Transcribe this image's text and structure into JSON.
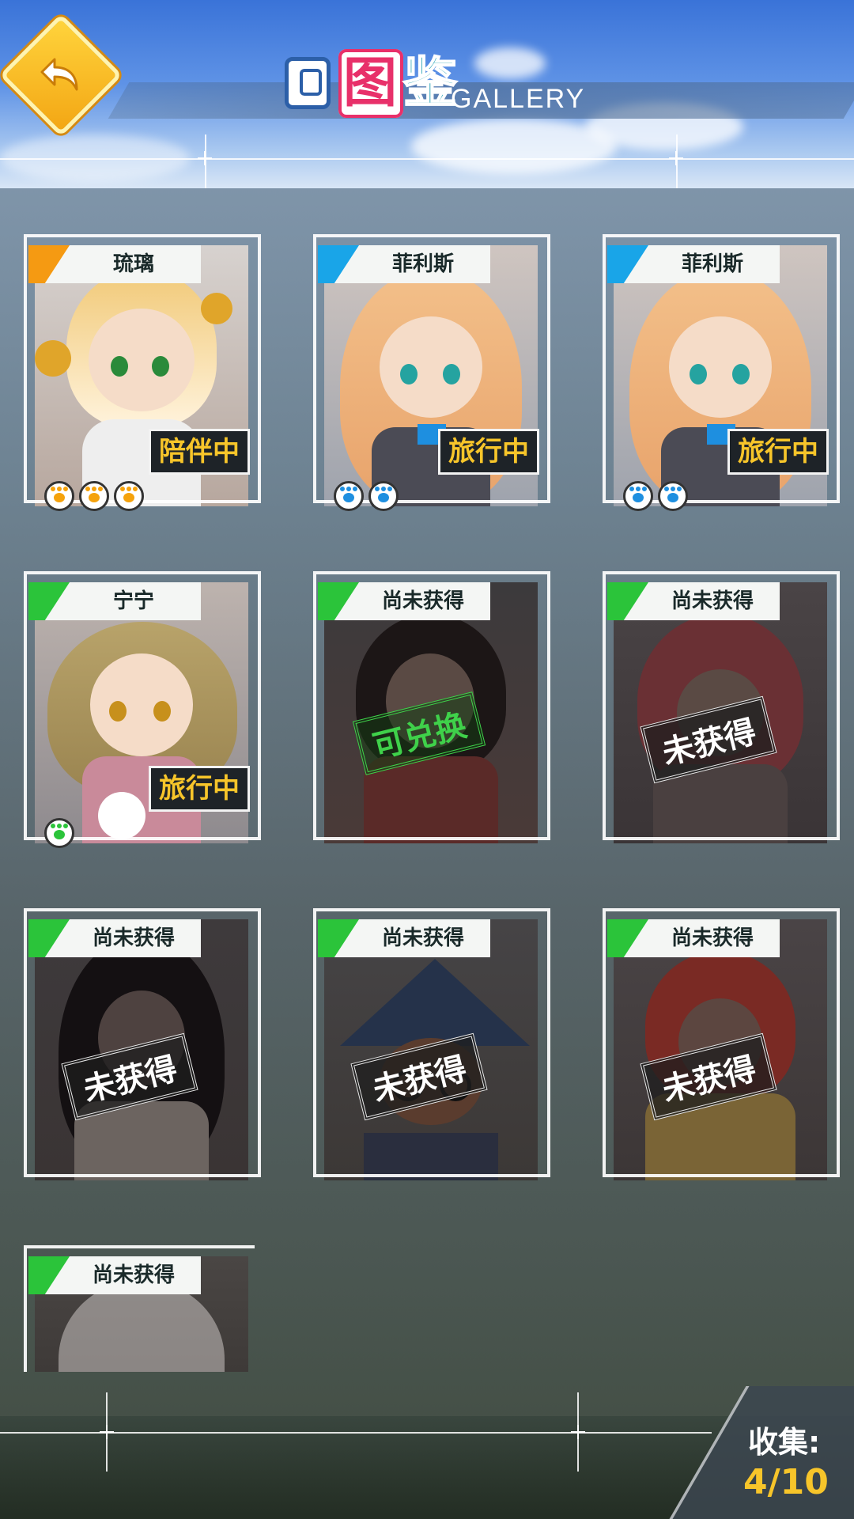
{
  "header": {
    "back_icon": "back-arrow-icon",
    "title_char1": "图",
    "title_char2": "鉴",
    "title_en": "GALLERY"
  },
  "cards": [
    {
      "name": "琉璃",
      "status": "陪伴中",
      "accent": "#f59a12",
      "paws": 3,
      "paw_color": "#f5a20c",
      "state": "owned"
    },
    {
      "name": "菲利斯",
      "status": "旅行中",
      "accent": "#19a5e8",
      "paws": 2,
      "paw_color": "#1e8fe0",
      "state": "owned"
    },
    {
      "name": "菲利斯",
      "status": "旅行中",
      "accent": "#19a5e8",
      "paws": 2,
      "paw_color": "#1e8fe0",
      "state": "owned"
    },
    {
      "name": "宁宁",
      "status": "旅行中",
      "accent": "#2bc43a",
      "paws": 1,
      "paw_color": "#2bc43a",
      "state": "owned"
    },
    {
      "name": "尚未获得",
      "status": "可兑换",
      "accent": "#2bc43a",
      "paws": 0,
      "state": "exchangeable"
    },
    {
      "name": "尚未获得",
      "status": "未获得",
      "accent": "#2bc43a",
      "paws": 0,
      "state": "locked"
    },
    {
      "name": "尚未获得",
      "status": "未获得",
      "accent": "#2bc43a",
      "paws": 0,
      "state": "locked"
    },
    {
      "name": "尚未获得",
      "status": "未获得",
      "accent": "#2bc43a",
      "paws": 0,
      "state": "locked"
    },
    {
      "name": "尚未获得",
      "status": "未获得",
      "accent": "#2bc43a",
      "paws": 0,
      "state": "locked"
    },
    {
      "name": "尚未获得",
      "status": "",
      "accent": "#2bc43a",
      "paws": 0,
      "state": "locked"
    }
  ],
  "footer": {
    "collect_label": "收集:",
    "collect_value": "4/10"
  }
}
